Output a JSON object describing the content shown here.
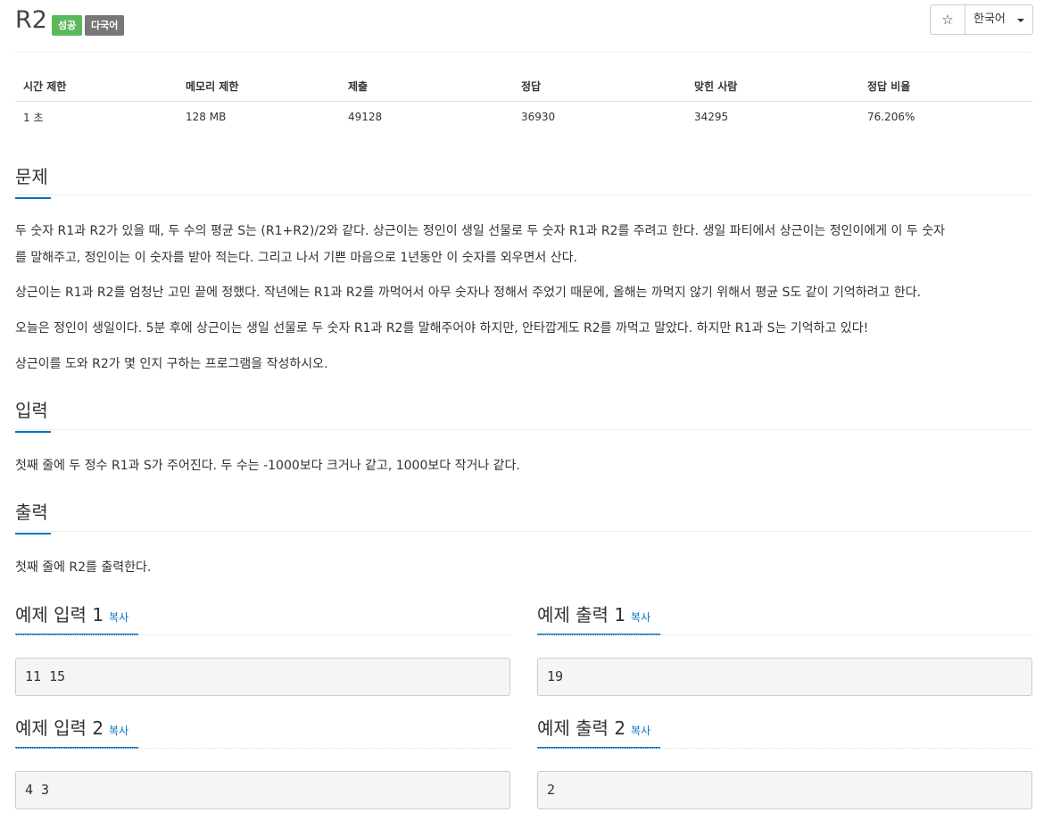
{
  "problem": {
    "title": "R2",
    "labels": {
      "success": "성공",
      "multilang": "다국어"
    },
    "star_icon": "☆",
    "language": "한국어"
  },
  "info": {
    "headers": [
      "시간 제한",
      "메모리 제한",
      "제출",
      "정답",
      "맞힌 사람",
      "정답 비율"
    ],
    "values": [
      "1 초",
      "128 MB",
      "49128",
      "36930",
      "34295",
      "76.206%"
    ]
  },
  "sections": {
    "description": {
      "heading": "문제",
      "p1a": "두 숫자 R1과 R2가 있을 때, 두 수의 평균 S는 (R1+R2)/2와 같다. 상근이는 정인이 생일 선물로 두 숫자 R1과 R2를 주려고 한다. 생일 파티에서 상근이는 정인이에게 이 두 숫자",
      "p1b": "를 말해주고, 정인이는 이 숫자를 받아 적는다. 그리고 나서 기쁜 마음으로 1년동안 이 숫자를 외우면서 산다.",
      "p2": "상근이는 R1과 R2를 엄청난 고민 끝에 정했다. 작년에는 R1과 R2를 까먹어서 아무 숫자나 정해서 주었기 때문에, 올해는 까먹지 않기 위해서 평균 S도 같이 기억하려고 한다.",
      "p3": "오늘은 정인이 생일이다. 5분 후에 상근이는 생일 선물로 두 숫자 R1과 R2를 말해주어야 하지만, 안타깝게도 R2를 까먹고 말았다. 하지만 R1과 S는 기억하고 있다!",
      "p4": "상근이를 도와 R2가 몇 인지 구하는 프로그램을 작성하시오."
    },
    "input": {
      "heading": "입력",
      "text": "첫째 줄에 두 정수 R1과 S가 주어진다. 두 수는 -1000보다 크거나 같고, 1000보다 작거나 같다."
    },
    "output": {
      "heading": "출력",
      "text": "첫째 줄에 R2를 출력한다."
    }
  },
  "samples": {
    "copy_label": "복사",
    "in1": {
      "heading": "예제 입력 1",
      "data": "11 15"
    },
    "out1": {
      "heading": "예제 출력 1",
      "data": "19"
    },
    "in2": {
      "heading": "예제 입력 2",
      "data": "4 3"
    },
    "out2": {
      "heading": "예제 출력 2",
      "data": "2"
    }
  },
  "colors": {
    "accent": "#0076c0",
    "success": "#5cb85c",
    "label_gray": "#777777"
  }
}
